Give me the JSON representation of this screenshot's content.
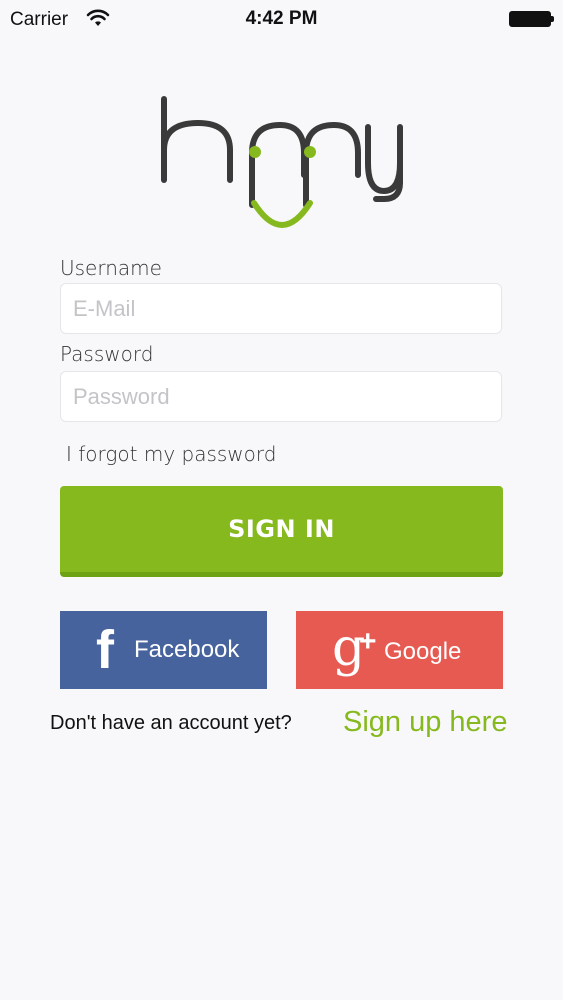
{
  "status_bar": {
    "carrier": "Carrier",
    "time": "4:42 PM"
  },
  "logo": {
    "icon": "hppy-logo",
    "brand_color": "#86b91e",
    "dark_color": "#3a3a3a"
  },
  "login": {
    "username_label": "Username",
    "username_placeholder": "E-Mail",
    "password_label": "Password",
    "password_placeholder": "Password",
    "forgot_link": "I forgot my password",
    "signin_label": "SIGN IN"
  },
  "social": {
    "facebook_label": "Facebook",
    "facebook_glyph": "f",
    "facebook_color": "#47639d",
    "google_label": "Google",
    "google_glyph": "g",
    "google_plus": "+",
    "google_color": "#e65a52"
  },
  "signup": {
    "prompt": "Don't have an account yet?",
    "link": "Sign up here"
  }
}
